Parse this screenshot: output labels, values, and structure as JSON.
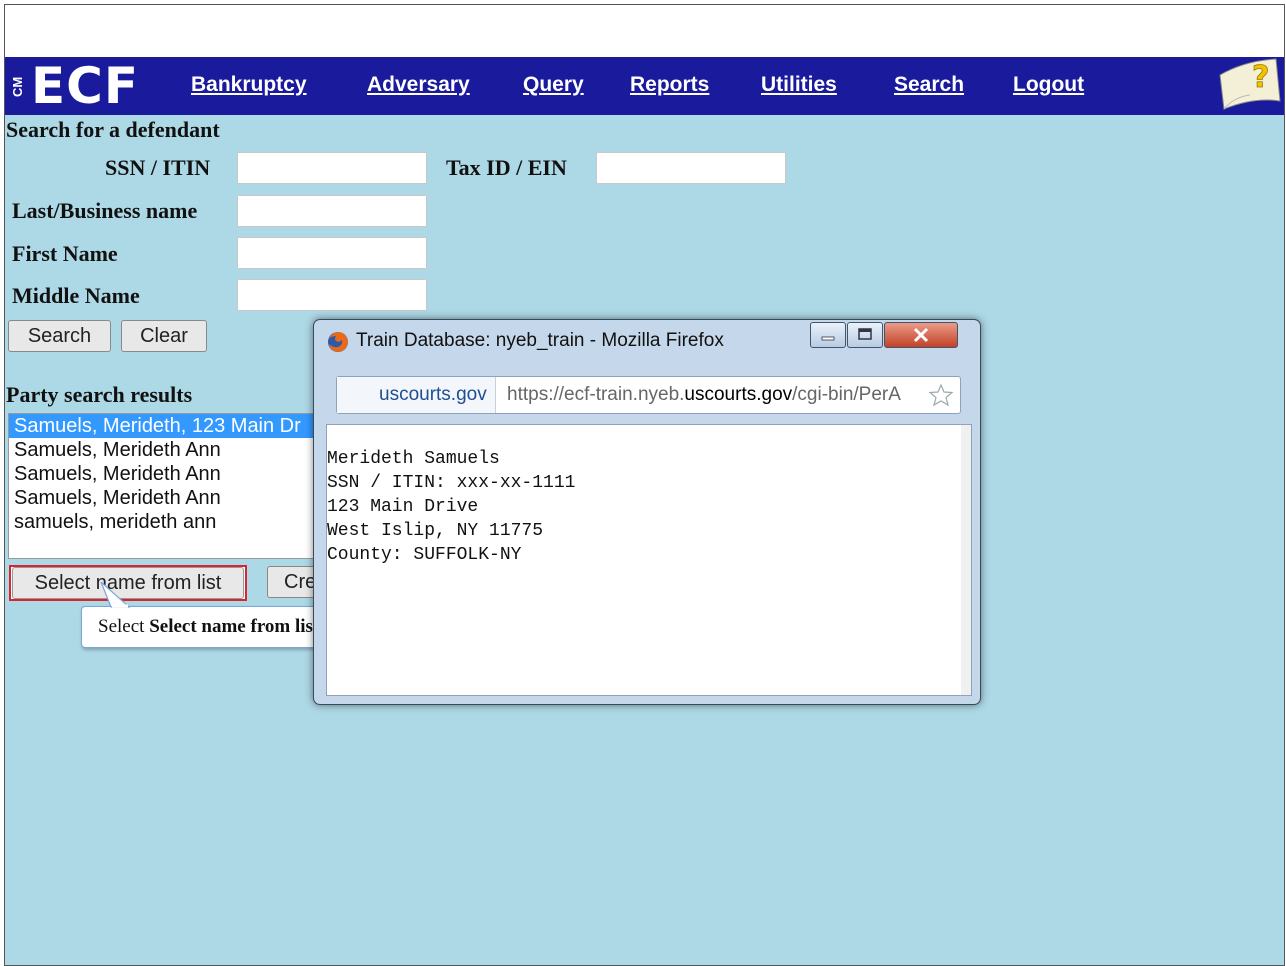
{
  "app": {
    "logo_cm": "CM",
    "logo_text": "ECF"
  },
  "nav": {
    "items": [
      "Bankruptcy",
      "Adversary",
      "Query",
      "Reports",
      "Utilities",
      "Search",
      "Logout"
    ]
  },
  "form": {
    "title": "Search for a defendant",
    "ssn_label": "SSN / ITIN",
    "taxid_label": "Tax ID / EIN",
    "last_label": "Last/Business name",
    "first_label": "First Name",
    "middle_label": "Middle Name",
    "search_button": "Search",
    "clear_button": "Clear"
  },
  "results": {
    "title": "Party search results",
    "items": [
      "Samuels, Merideth, 123 Main Dr",
      "Samuels, Merideth Ann",
      "Samuels, Merideth Ann",
      "Samuels, Merideth Ann",
      "samuels, merideth ann"
    ],
    "selected_index": 0,
    "select_button": "Select name from list",
    "create_button": "Cre"
  },
  "tooltip": {
    "prefix": "Select",
    "bold": "Select name from list"
  },
  "popup": {
    "title": "Train Database: nyeb_train - Mozilla Firefox",
    "url_domain": "uscourts.gov",
    "url_prefix": "https://ecf-train.nyeb.",
    "url_host": "uscourts.gov",
    "url_suffix": "/cgi-bin/PerA",
    "lines": [
      "Merideth Samuels",
      "SSN / ITIN: xxx-xx-1111",
      "123 Main Drive",
      "West Islip, NY 11775",
      "County: SUFFOLK-NY"
    ]
  },
  "colors": {
    "navbar": "#1a1a9c",
    "background": "#add8e6",
    "selection": "#3399ff",
    "highlight_box": "#d9262e"
  }
}
